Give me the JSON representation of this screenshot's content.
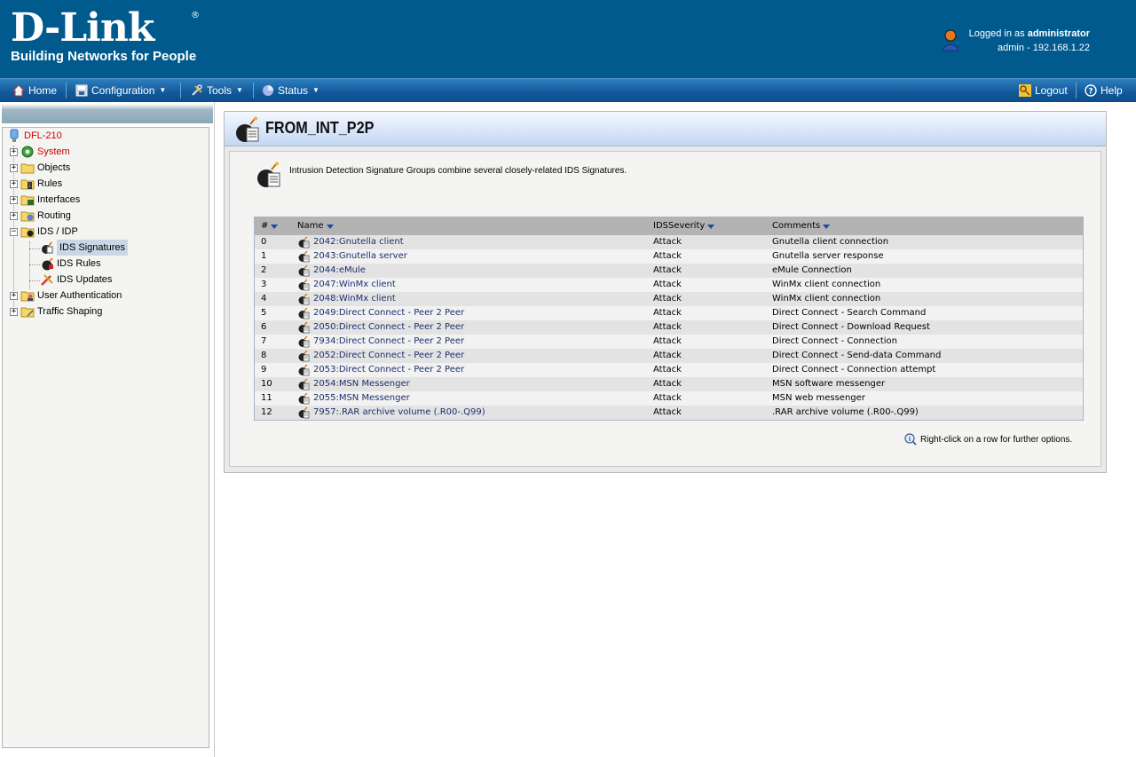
{
  "header": {
    "brand": "D-Link",
    "registered": "®",
    "tagline": "Building Networks for People",
    "logged_in_prefix": "Logged in as ",
    "username": "administrator",
    "session": "admin - 192.168.1.22"
  },
  "menu": {
    "home": "Home",
    "configuration": "Configuration",
    "tools": "Tools",
    "status": "Status",
    "logout": "Logout",
    "help": "Help"
  },
  "tree": {
    "root": "DFL-210",
    "system": "System",
    "objects": "Objects",
    "rules": "Rules",
    "interfaces": "Interfaces",
    "routing": "Routing",
    "ids_idp": "IDS / IDP",
    "ids_signatures": "IDS Signatures",
    "ids_rules": "IDS Rules",
    "ids_updates": "IDS Updates",
    "user_auth": "User Authentication",
    "traffic_shaping": "Traffic Shaping"
  },
  "panel": {
    "title": "FROM_INT_P2P",
    "description": "Intrusion Detection Signature Groups combine several closely-related IDS Signatures.",
    "hint": "Right-click on a row for further options."
  },
  "grid": {
    "columns": [
      "#",
      "Name",
      "IDSSeverity",
      "Comments"
    ],
    "rows": [
      {
        "num": "0",
        "name": "2042:Gnutella client",
        "severity": "Attack",
        "comment": "Gnutella client connection"
      },
      {
        "num": "1",
        "name": "2043:Gnutella server",
        "severity": "Attack",
        "comment": "Gnutella server response"
      },
      {
        "num": "2",
        "name": "2044:eMule",
        "severity": "Attack",
        "comment": "eMule Connection"
      },
      {
        "num": "3",
        "name": "2047:WinMx client",
        "severity": "Attack",
        "comment": "WinMx client connection"
      },
      {
        "num": "4",
        "name": "2048:WinMx client",
        "severity": "Attack",
        "comment": "WinMx client connection"
      },
      {
        "num": "5",
        "name": "2049:Direct Connect - Peer 2 Peer",
        "severity": "Attack",
        "comment": "Direct Connect - Search Command"
      },
      {
        "num": "6",
        "name": "2050:Direct Connect - Peer 2 Peer",
        "severity": "Attack",
        "comment": "Direct Connect - Download Request"
      },
      {
        "num": "7",
        "name": "7934:Direct Connect - Peer 2 Peer",
        "severity": "Attack",
        "comment": "Direct Connect - Connection"
      },
      {
        "num": "8",
        "name": "2052:Direct Connect - Peer 2 Peer",
        "severity": "Attack",
        "comment": "Direct Connect - Send-data Command"
      },
      {
        "num": "9",
        "name": "2053:Direct Connect - Peer 2 Peer",
        "severity": "Attack",
        "comment": "Direct Connect - Connection attempt"
      },
      {
        "num": "10",
        "name": "2054:MSN Messenger",
        "severity": "Attack",
        "comment": "MSN software messenger"
      },
      {
        "num": "11",
        "name": "2055:MSN Messenger",
        "severity": "Attack",
        "comment": "MSN web messenger"
      },
      {
        "num": "12",
        "name": "7957:.RAR archive volume (.R00-.Q99)",
        "severity": "Attack",
        "comment": ".RAR archive volume (.R00-.Q99)"
      }
    ]
  },
  "colors": {
    "header_bg": "#015a8e",
    "tree_red": "#cc0000",
    "link_blue": "#1d2f6b"
  }
}
